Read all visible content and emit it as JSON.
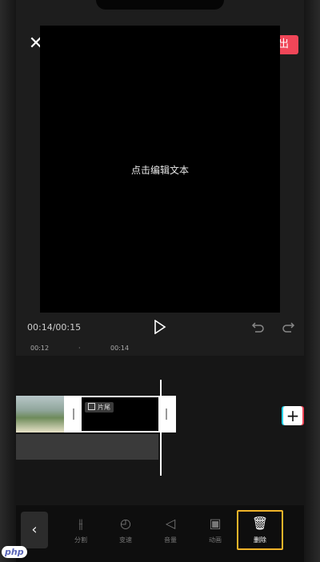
{
  "header": {
    "close_icon": "close-icon",
    "fullscreen_icon": "fullscreen-icon",
    "export_label": "导出",
    "export_color": "#f04658"
  },
  "preview": {
    "text": "点击编辑文本"
  },
  "playback": {
    "time": "00:14/00:15",
    "play_icon": "play-icon",
    "undo_icon": "undo-icon",
    "redo_icon": "redo-icon"
  },
  "ruler": {
    "ticks": [
      "00:12",
      "·",
      "00:14"
    ]
  },
  "timeline": {
    "selected_clip_label": "片尾",
    "add_icon": "+"
  },
  "toolbar": {
    "back_icon": "‹",
    "items": [
      {
        "label": "分割",
        "icon": "split-icon"
      },
      {
        "label": "变速",
        "icon": "speed-icon"
      },
      {
        "label": "音量",
        "icon": "volume-icon"
      },
      {
        "label": "动画",
        "icon": "animation-icon"
      },
      {
        "label": "删除",
        "icon": "delete-icon"
      }
    ]
  },
  "watermark": "php"
}
